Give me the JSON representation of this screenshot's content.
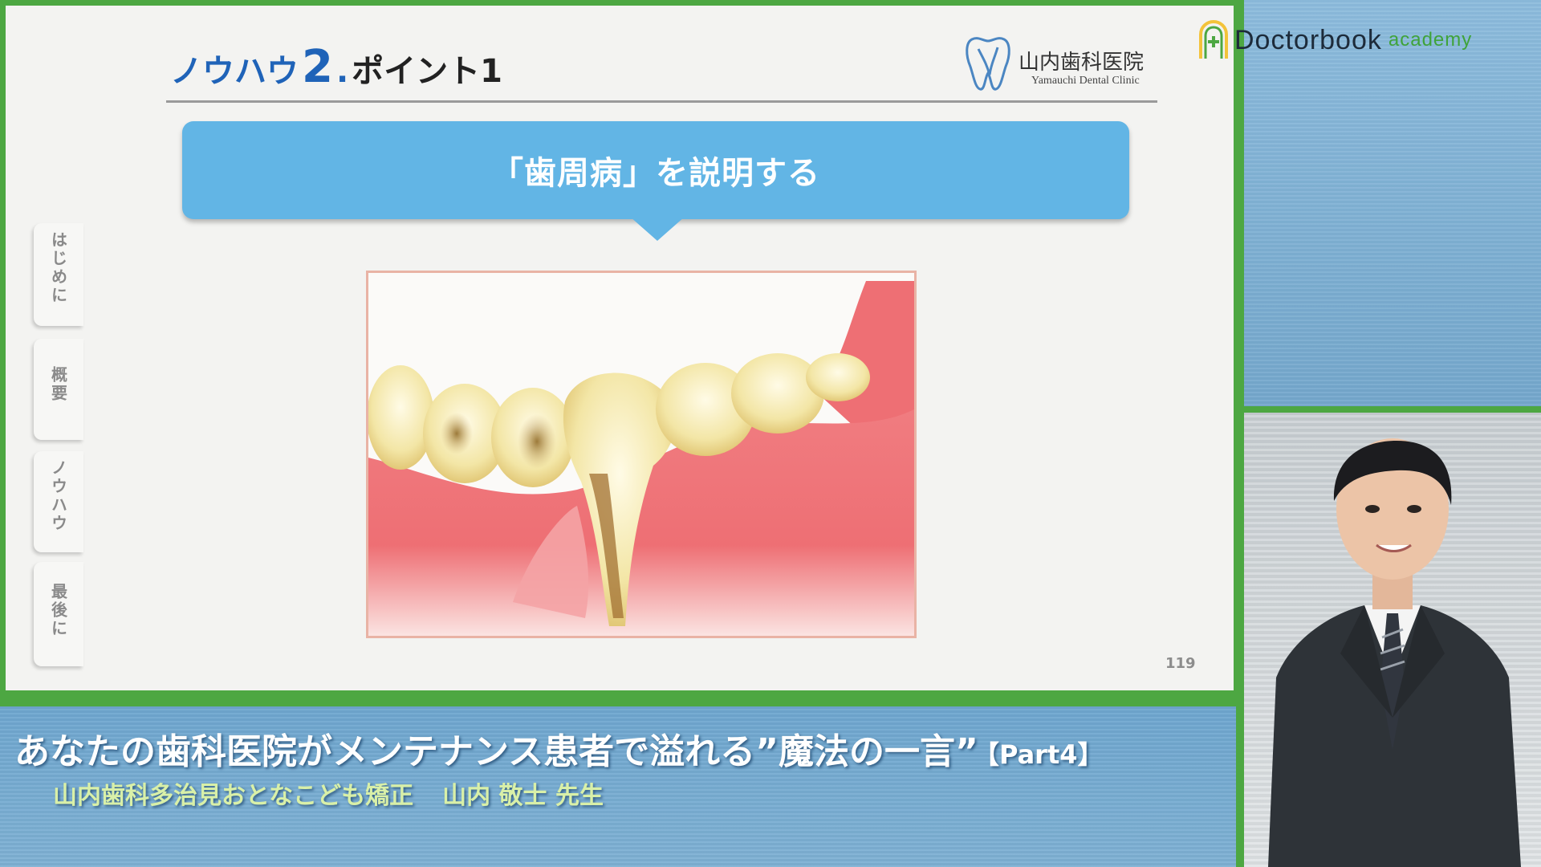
{
  "slide": {
    "heading_main": "ノウハウ",
    "heading_number": "2",
    "heading_dot": ".",
    "heading_sub": "ポイント1",
    "callout_text": "「歯周病」を説明する",
    "page_number": "119",
    "illustration_label": "periodontal-disease-teeth-illustration"
  },
  "clinic_logo": {
    "name_jp": "山内歯科医院",
    "name_en": "Yamauchi Dental Clinic"
  },
  "side_tabs": [
    {
      "label": "はじめに"
    },
    {
      "label": "概要"
    },
    {
      "label": "ノウハウ"
    },
    {
      "label": "最後に"
    }
  ],
  "caption": {
    "title": "あなたの歯科医院がメンテナンス患者で溢れる”魔法の一言”",
    "part": "【Part4】",
    "presenter_org": "山内歯科多治見おとなこども矯正",
    "presenter_name": "山内 敬士 先生"
  },
  "brand": {
    "word": "Doctorbook",
    "sub": "academy",
    "icon": "doctorbook-house-icon"
  },
  "colors": {
    "frame_green": "#4da742",
    "callout_blue": "#62b5e5",
    "heading_blue": "#1f63b8"
  }
}
